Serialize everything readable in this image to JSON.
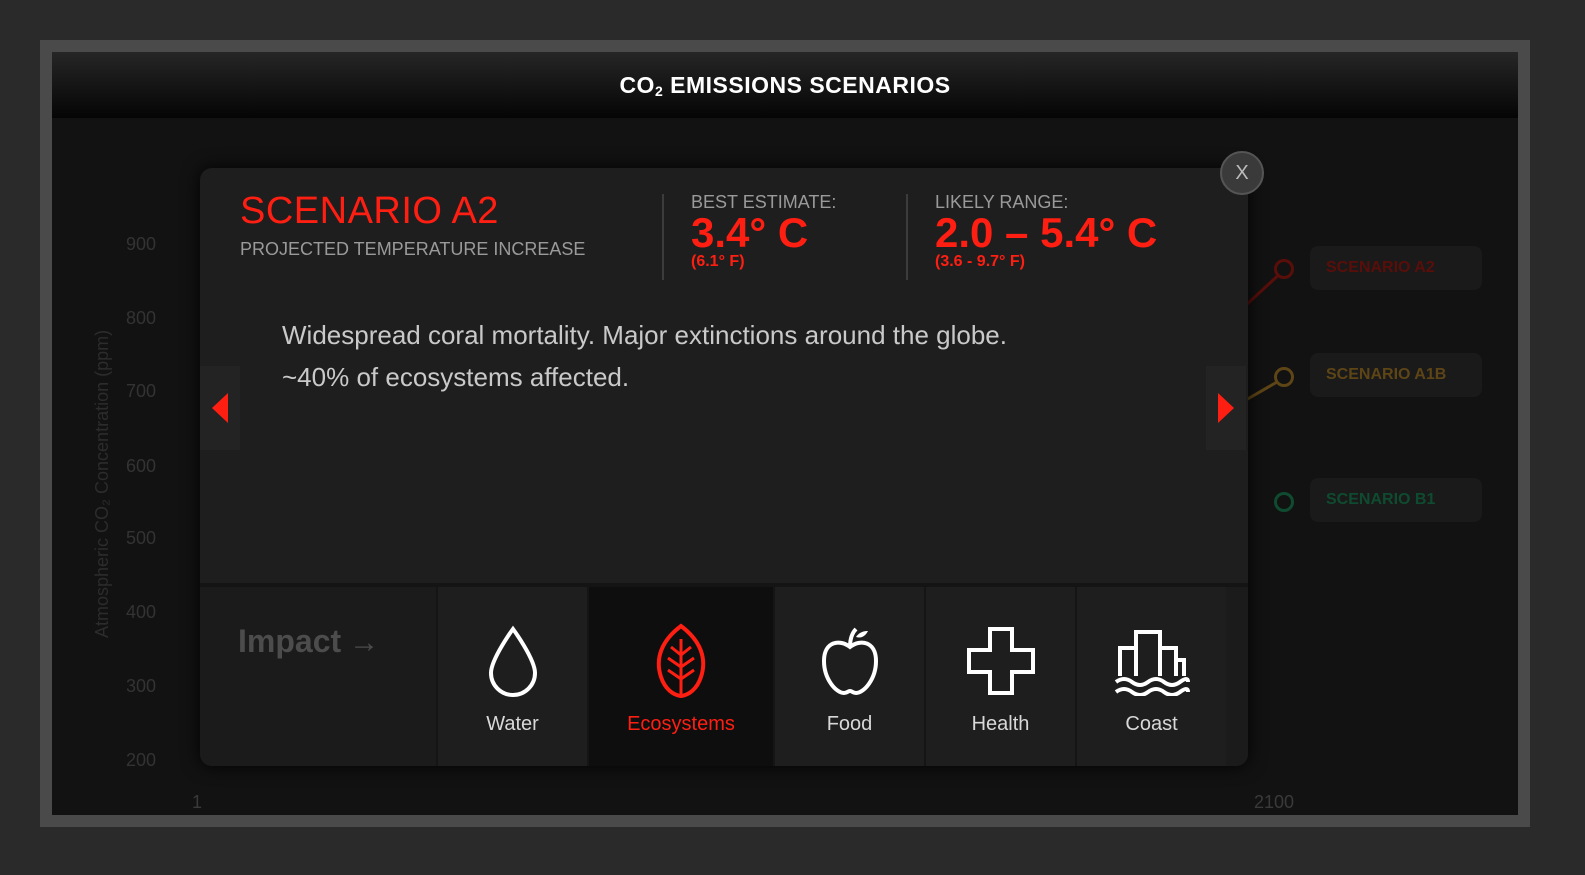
{
  "header": {
    "title_prefix": "CO",
    "title_sub": "2",
    "title_suffix": " EMISSIONS SCENARIOS"
  },
  "background_chart": {
    "y_ticks": [
      "900",
      "800",
      "700",
      "600",
      "500",
      "400",
      "300",
      "200"
    ],
    "y_label": "Atmospheric CO₂ Concentration (ppm)",
    "x_ticks": [
      "1",
      "2100"
    ],
    "scenarios": [
      {
        "label": "SCENARIO A2",
        "color": "#5a0e0a"
      },
      {
        "label": "SCENARIO A1B",
        "color": "#5e4516"
      },
      {
        "label": "SCENARIO B1",
        "color": "#0f4b30"
      }
    ]
  },
  "modal": {
    "close_label": "X",
    "scenario_title": "SCENARIO A2",
    "scenario_subtitle": "PROJECTED TEMPERATURE INCREASE",
    "best_estimate": {
      "label": "BEST ESTIMATE:",
      "value": "3.4° C",
      "sub": "(6.1° F)"
    },
    "likely_range": {
      "label": "LIKELY RANGE:",
      "value": "2.0 – 5.4° C",
      "sub": "(3.6 - 9.7° F)"
    },
    "description_line1": "Widespread coral mortality. Major extinctions around the globe.",
    "description_line2": "~40% of ecosystems affected.",
    "prev_icon": "left-triangle-icon",
    "next_icon": "right-triangle-icon",
    "accent_color": "#ff1e12"
  },
  "impact": {
    "heading": "Impact",
    "heading_icon": "arrow-right-icon",
    "items": [
      {
        "label": "Water",
        "icon": "droplet-icon",
        "selected": false
      },
      {
        "label": "Ecosystems",
        "icon": "leaf-icon",
        "selected": true
      },
      {
        "label": "Food",
        "icon": "apple-icon",
        "selected": false
      },
      {
        "label": "Health",
        "icon": "cross-icon",
        "selected": false
      },
      {
        "label": "Coast",
        "icon": "city-flood-icon",
        "selected": false
      }
    ]
  }
}
